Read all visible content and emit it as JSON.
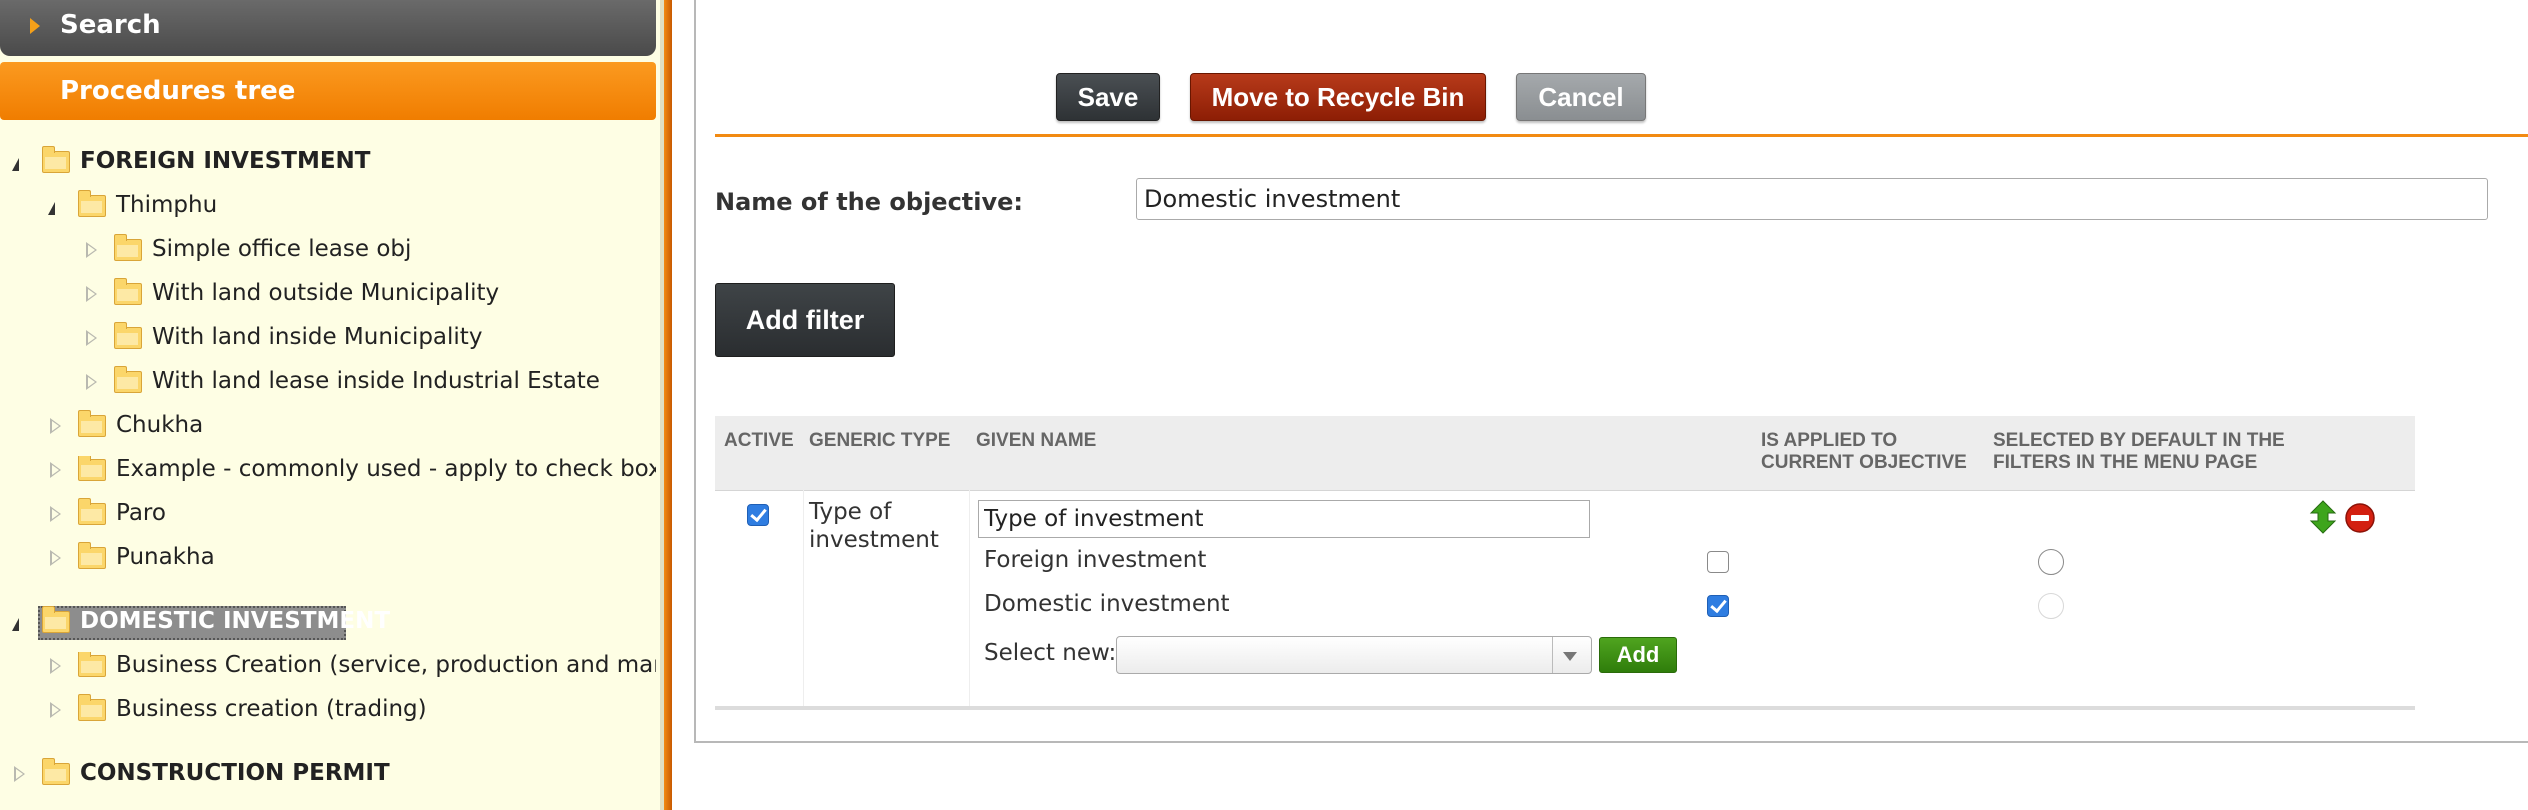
{
  "sidebar": {
    "search_label": "Search",
    "tree_header": "Procedures tree",
    "tree": [
      {
        "label": "FOREIGN INVESTMENT",
        "state": "expanded"
      },
      {
        "label": "Thimphu",
        "state": "expanded"
      },
      {
        "label": "Simple office lease obj",
        "state": "collapsed"
      },
      {
        "label": "With land outside Municipality",
        "state": "collapsed"
      },
      {
        "label": "With land inside Municipality",
        "state": "collapsed"
      },
      {
        "label": "With land lease inside Industrial Estate",
        "state": "collapsed"
      },
      {
        "label": "Chukha",
        "state": "collapsed"
      },
      {
        "label": "Example - commonly used - apply to check box - H",
        "state": "collapsed"
      },
      {
        "label": "Paro",
        "state": "collapsed"
      },
      {
        "label": "Punakha",
        "state": "collapsed"
      },
      {
        "label": "DOMESTIC INVESTMENT",
        "state": "expanded",
        "selected": true
      },
      {
        "label": "Business Creation (service, production and manufa",
        "state": "collapsed"
      },
      {
        "label": "Business creation (trading)",
        "state": "collapsed"
      },
      {
        "label": "CONSTRUCTION PERMIT",
        "state": "collapsed"
      }
    ]
  },
  "toolbar": {
    "save_label": "Save",
    "recycle_label": "Move to Recycle Bin",
    "cancel_label": "Cancel"
  },
  "form": {
    "name_label": "Name of the objective:",
    "name_value": "Domestic investment",
    "add_filter_label": "Add filter"
  },
  "filters_table": {
    "headers": {
      "active": "ACTIVE",
      "generic_type": "GENERIC TYPE",
      "given_name": "GIVEN NAME",
      "applied_line1": "IS APPLIED TO",
      "applied_line2": "CURRENT OBJECTIVE",
      "default_line1": "SELECTED BY DEFAULT IN THE",
      "default_line2": "FILTERS IN THE MENU PAGE"
    },
    "row": {
      "active": true,
      "generic_type_line1": "Type of",
      "generic_type_line2": "investment",
      "given_name_value": "Type of investment",
      "options": [
        {
          "label": "Foreign investment",
          "applied": false,
          "default_enabled": true
        },
        {
          "label": "Domestic investment",
          "applied": true,
          "default_enabled": false
        }
      ],
      "select_new_label": "Select new:",
      "select_value": "",
      "add_label": "Add"
    }
  },
  "icons": {
    "move": "move-up-down-icon",
    "remove": "remove-icon",
    "folder": "folder-icon"
  },
  "colors": {
    "accent_orange": "#f28a12",
    "save": "#2e3235",
    "recycle": "#8d1e05",
    "cancel": "#8a8e91",
    "add": "#2f7d0b",
    "checkbox": "#2f7de1"
  }
}
